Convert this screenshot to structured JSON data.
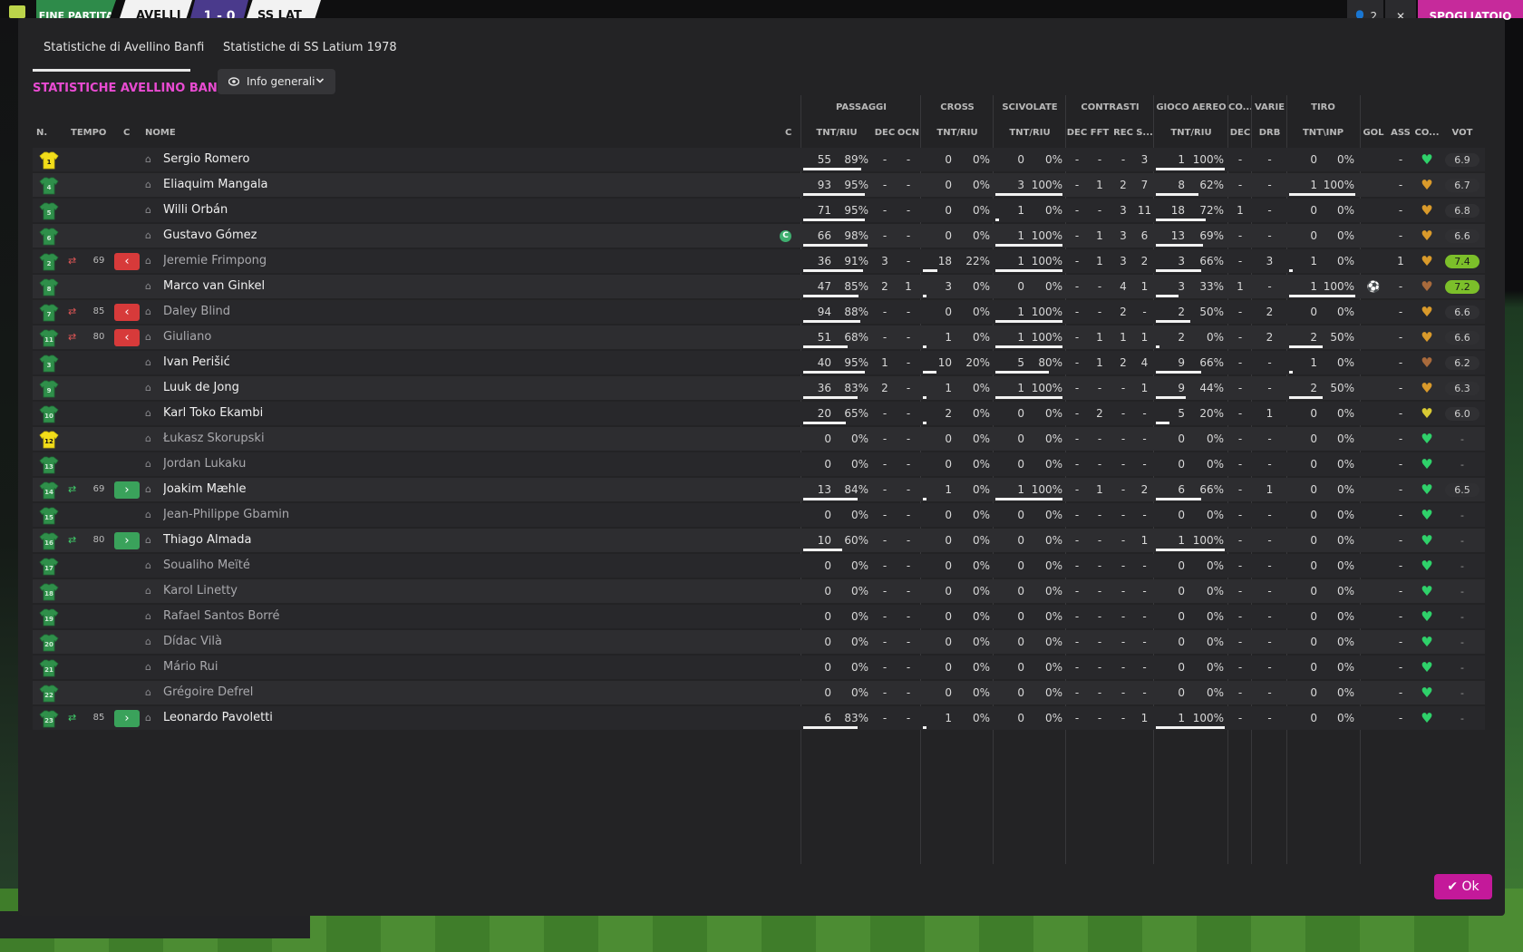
{
  "topbar": {
    "match_state": "FINE PARTITA",
    "home_short": "AVELLI",
    "score": "1 - 0",
    "away_short": "SS LAT",
    "btn_people": "👤 2",
    "btn_close": "✕",
    "locker_room": "SPOGLIATOIO"
  },
  "tabs": [
    "Statistiche di Avellino Banfi",
    "Statistiche di SS Latium 1978"
  ],
  "section_title": "STATISTICHE AVELLINO BANFI",
  "view_select": "Info generali",
  "groups": {
    "passaggi": "PASSAGGI",
    "cross": "CROSS",
    "scivolate": "SCIVOLATE",
    "contrasti": "CONTRASTI",
    "gioco_aereo": "GIOCO AEREO",
    "co": "CO...",
    "varie": "VARIE",
    "tiro": "TIRO"
  },
  "headers": {
    "n": "N.",
    "tempo": "TEMPO",
    "c": "C",
    "nome": "NOME",
    "c2": "C",
    "pass_tnt": "TNT/RIU",
    "pass_dec": "DEC",
    "pass_ocn": "OCN",
    "cross_tnt": "TNT/RIU",
    "sciv_tnt": "TNT/RIU",
    "con_dec": "DEC",
    "con_fft": "FFT",
    "con_rec": "REC",
    "con_s": "S...",
    "aereo_tnt": "TNT/RIU",
    "co_dec": "DEC",
    "varie_drb": "DRB",
    "tiro_tnt": "TNT\\INP",
    "gol": "GOL",
    "ass": "ASS",
    "cond": "CO...",
    "vot": "VOT"
  },
  "colors": {
    "accent": "#e94bd2",
    "ok": "#c4199a",
    "shirt_gk": "#f2dd1a",
    "shirt_field": "#2f8f4a",
    "sub_out": "#d73a3a",
    "sub_in": "#3aa25b"
  },
  "players": [
    {
      "num": "1",
      "gk": true,
      "sub": "",
      "min": "",
      "name": "Sergio Romero",
      "dim": false,
      "capt": false,
      "p": [
        "55",
        "89%"
      ],
      "pdec": "-",
      "pocn": "-",
      "cr": [
        "0",
        "0%"
      ],
      "sc": [
        "0",
        "0%"
      ],
      "cdec": "-",
      "cfft": "-",
      "crec": "-",
      "cs": "3",
      "ae": [
        "1",
        "100%"
      ],
      "codec": "-",
      "drb": "-",
      "ti": [
        "0",
        "0%"
      ],
      "gol": "",
      "ass": "-",
      "heart": "green",
      "vot": "6.9",
      "vhi": false
    },
    {
      "num": "4",
      "gk": false,
      "sub": "",
      "min": "",
      "name": "Eliaquim Mangala",
      "dim": false,
      "capt": false,
      "p": [
        "93",
        "95%"
      ],
      "pdec": "-",
      "pocn": "-",
      "cr": [
        "0",
        "0%"
      ],
      "sc": [
        "3",
        "100%"
      ],
      "cdec": "-",
      "cfft": "1",
      "crec": "2",
      "cs": "7",
      "ae": [
        "8",
        "62%"
      ],
      "codec": "-",
      "drb": "-",
      "ti": [
        "1",
        "100%"
      ],
      "gol": "",
      "ass": "-",
      "heart": "amber",
      "vot": "6.7",
      "vhi": false
    },
    {
      "num": "5",
      "gk": false,
      "sub": "",
      "min": "",
      "name": "Willi Orbán",
      "dim": false,
      "capt": false,
      "p": [
        "71",
        "95%"
      ],
      "pdec": "-",
      "pocn": "-",
      "cr": [
        "0",
        "0%"
      ],
      "sc": [
        "1",
        "0%"
      ],
      "cdec": "-",
      "cfft": "-",
      "crec": "3",
      "cs": "11",
      "ae": [
        "18",
        "72%"
      ],
      "codec": "1",
      "drb": "-",
      "ti": [
        "0",
        "0%"
      ],
      "gol": "",
      "ass": "-",
      "heart": "amber",
      "vot": "6.8",
      "vhi": false
    },
    {
      "num": "6",
      "gk": false,
      "sub": "",
      "min": "",
      "name": "Gustavo Gómez",
      "dim": false,
      "capt": true,
      "p": [
        "66",
        "98%"
      ],
      "pdec": "-",
      "pocn": "-",
      "cr": [
        "0",
        "0%"
      ],
      "sc": [
        "1",
        "100%"
      ],
      "cdec": "-",
      "cfft": "1",
      "crec": "3",
      "cs": "6",
      "ae": [
        "13",
        "69%"
      ],
      "codec": "-",
      "drb": "-",
      "ti": [
        "0",
        "0%"
      ],
      "gol": "",
      "ass": "-",
      "heart": "amber",
      "vot": "6.6",
      "vhi": false
    },
    {
      "num": "2",
      "gk": false,
      "sub": "out",
      "min": "69",
      "name": "Jeremie Frimpong",
      "dim": true,
      "capt": false,
      "p": [
        "36",
        "91%"
      ],
      "pdec": "3",
      "pocn": "-",
      "cr": [
        "18",
        "22%"
      ],
      "sc": [
        "1",
        "100%"
      ],
      "cdec": "-",
      "cfft": "1",
      "crec": "3",
      "cs": "2",
      "ae": [
        "3",
        "66%"
      ],
      "codec": "-",
      "drb": "3",
      "ti": [
        "1",
        "0%"
      ],
      "gol": "",
      "ass": "1",
      "heart": "amber",
      "vot": "7.4",
      "vhi": true
    },
    {
      "num": "8",
      "gk": false,
      "sub": "",
      "min": "",
      "name": "Marco van Ginkel",
      "dim": false,
      "capt": false,
      "p": [
        "47",
        "85%"
      ],
      "pdec": "2",
      "pocn": "1",
      "cr": [
        "3",
        "0%"
      ],
      "sc": [
        "0",
        "0%"
      ],
      "cdec": "-",
      "cfft": "-",
      "crec": "4",
      "cs": "1",
      "ae": [
        "3",
        "33%"
      ],
      "codec": "1",
      "drb": "-",
      "ti": [
        "1",
        "100%"
      ],
      "gol": "⚽",
      "ass": "-",
      "heart": "brown",
      "vot": "7.2",
      "vhi": true
    },
    {
      "num": "7",
      "gk": false,
      "sub": "out",
      "min": "85",
      "name": "Daley Blind",
      "dim": true,
      "capt": false,
      "p": [
        "94",
        "88%"
      ],
      "pdec": "-",
      "pocn": "-",
      "cr": [
        "0",
        "0%"
      ],
      "sc": [
        "1",
        "100%"
      ],
      "cdec": "-",
      "cfft": "-",
      "crec": "2",
      "cs": "-",
      "ae": [
        "2",
        "50%"
      ],
      "codec": "-",
      "drb": "2",
      "ti": [
        "0",
        "0%"
      ],
      "gol": "",
      "ass": "-",
      "heart": "amber",
      "vot": "6.6",
      "vhi": false
    },
    {
      "num": "11",
      "gk": false,
      "sub": "out",
      "min": "80",
      "name": "Giuliano",
      "dim": true,
      "capt": false,
      "p": [
        "51",
        "68%"
      ],
      "pdec": "-",
      "pocn": "-",
      "cr": [
        "1",
        "0%"
      ],
      "sc": [
        "1",
        "100%"
      ],
      "cdec": "-",
      "cfft": "1",
      "crec": "1",
      "cs": "1",
      "ae": [
        "2",
        "0%"
      ],
      "codec": "-",
      "drb": "2",
      "ti": [
        "2",
        "50%"
      ],
      "gol": "",
      "ass": "-",
      "heart": "amber",
      "vot": "6.6",
      "vhi": false
    },
    {
      "num": "3",
      "gk": false,
      "sub": "",
      "min": "",
      "name": "Ivan Perišić",
      "dim": false,
      "capt": false,
      "p": [
        "40",
        "95%"
      ],
      "pdec": "1",
      "pocn": "-",
      "cr": [
        "10",
        "20%"
      ],
      "sc": [
        "5",
        "80%"
      ],
      "cdec": "-",
      "cfft": "1",
      "crec": "2",
      "cs": "4",
      "ae": [
        "9",
        "66%"
      ],
      "codec": "-",
      "drb": "-",
      "ti": [
        "1",
        "0%"
      ],
      "gol": "",
      "ass": "-",
      "heart": "brown",
      "vot": "6.2",
      "vhi": false
    },
    {
      "num": "9",
      "gk": false,
      "sub": "",
      "min": "",
      "name": "Luuk de Jong",
      "dim": false,
      "capt": false,
      "p": [
        "36",
        "83%"
      ],
      "pdec": "2",
      "pocn": "-",
      "cr": [
        "1",
        "0%"
      ],
      "sc": [
        "1",
        "100%"
      ],
      "cdec": "-",
      "cfft": "-",
      "crec": "-",
      "cs": "1",
      "ae": [
        "9",
        "44%"
      ],
      "codec": "-",
      "drb": "-",
      "ti": [
        "2",
        "50%"
      ],
      "gol": "",
      "ass": "-",
      "heart": "amber",
      "vot": "6.3",
      "vhi": false
    },
    {
      "num": "10",
      "gk": false,
      "sub": "",
      "min": "",
      "name": "Karl Toko Ekambi",
      "dim": false,
      "capt": false,
      "p": [
        "20",
        "65%"
      ],
      "pdec": "-",
      "pocn": "-",
      "cr": [
        "2",
        "0%"
      ],
      "sc": [
        "0",
        "0%"
      ],
      "cdec": "-",
      "cfft": "2",
      "crec": "-",
      "cs": "-",
      "ae": [
        "5",
        "20%"
      ],
      "codec": "-",
      "drb": "1",
      "ti": [
        "0",
        "0%"
      ],
      "gol": "",
      "ass": "-",
      "heart": "yellow",
      "vot": "6.0",
      "vhi": false
    },
    {
      "num": "12",
      "gk": true,
      "sub": "",
      "min": "",
      "name": "Łukasz Skorupski",
      "dim": true,
      "capt": false,
      "p": [
        "0",
        "0%"
      ],
      "pdec": "-",
      "pocn": "-",
      "cr": [
        "0",
        "0%"
      ],
      "sc": [
        "0",
        "0%"
      ],
      "cdec": "-",
      "cfft": "-",
      "crec": "-",
      "cs": "-",
      "ae": [
        "0",
        "0%"
      ],
      "codec": "-",
      "drb": "-",
      "ti": [
        "0",
        "0%"
      ],
      "gol": "",
      "ass": "-",
      "heart": "green",
      "vot": "-",
      "vhi": false
    },
    {
      "num": "13",
      "gk": false,
      "sub": "",
      "min": "",
      "name": "Jordan Lukaku",
      "dim": true,
      "capt": false,
      "p": [
        "0",
        "0%"
      ],
      "pdec": "-",
      "pocn": "-",
      "cr": [
        "0",
        "0%"
      ],
      "sc": [
        "0",
        "0%"
      ],
      "cdec": "-",
      "cfft": "-",
      "crec": "-",
      "cs": "-",
      "ae": [
        "0",
        "0%"
      ],
      "codec": "-",
      "drb": "-",
      "ti": [
        "0",
        "0%"
      ],
      "gol": "",
      "ass": "-",
      "heart": "green",
      "vot": "-",
      "vhi": false
    },
    {
      "num": "14",
      "gk": false,
      "sub": "in",
      "min": "69",
      "name": "Joakim Mæhle",
      "dim": false,
      "capt": false,
      "p": [
        "13",
        "84%"
      ],
      "pdec": "-",
      "pocn": "-",
      "cr": [
        "1",
        "0%"
      ],
      "sc": [
        "1",
        "100%"
      ],
      "cdec": "-",
      "cfft": "1",
      "crec": "-",
      "cs": "2",
      "ae": [
        "6",
        "66%"
      ],
      "codec": "-",
      "drb": "1",
      "ti": [
        "0",
        "0%"
      ],
      "gol": "",
      "ass": "-",
      "heart": "green",
      "vot": "6.5",
      "vhi": false
    },
    {
      "num": "15",
      "gk": false,
      "sub": "",
      "min": "",
      "name": "Jean-Philippe Gbamin",
      "dim": true,
      "capt": false,
      "p": [
        "0",
        "0%"
      ],
      "pdec": "-",
      "pocn": "-",
      "cr": [
        "0",
        "0%"
      ],
      "sc": [
        "0",
        "0%"
      ],
      "cdec": "-",
      "cfft": "-",
      "crec": "-",
      "cs": "-",
      "ae": [
        "0",
        "0%"
      ],
      "codec": "-",
      "drb": "-",
      "ti": [
        "0",
        "0%"
      ],
      "gol": "",
      "ass": "-",
      "heart": "green",
      "vot": "-",
      "vhi": false
    },
    {
      "num": "16",
      "gk": false,
      "sub": "in",
      "min": "80",
      "name": "Thiago Almada",
      "dim": false,
      "capt": false,
      "p": [
        "10",
        "60%"
      ],
      "pdec": "-",
      "pocn": "-",
      "cr": [
        "0",
        "0%"
      ],
      "sc": [
        "0",
        "0%"
      ],
      "cdec": "-",
      "cfft": "-",
      "crec": "-",
      "cs": "1",
      "ae": [
        "1",
        "100%"
      ],
      "codec": "-",
      "drb": "-",
      "ti": [
        "0",
        "0%"
      ],
      "gol": "",
      "ass": "-",
      "heart": "green",
      "vot": "-",
      "vhi": false
    },
    {
      "num": "17",
      "gk": false,
      "sub": "",
      "min": "",
      "name": "Soualiho Meïté",
      "dim": true,
      "capt": false,
      "p": [
        "0",
        "0%"
      ],
      "pdec": "-",
      "pocn": "-",
      "cr": [
        "0",
        "0%"
      ],
      "sc": [
        "0",
        "0%"
      ],
      "cdec": "-",
      "cfft": "-",
      "crec": "-",
      "cs": "-",
      "ae": [
        "0",
        "0%"
      ],
      "codec": "-",
      "drb": "-",
      "ti": [
        "0",
        "0%"
      ],
      "gol": "",
      "ass": "-",
      "heart": "green",
      "vot": "-",
      "vhi": false
    },
    {
      "num": "18",
      "gk": false,
      "sub": "",
      "min": "",
      "name": "Karol Linetty",
      "dim": true,
      "capt": false,
      "p": [
        "0",
        "0%"
      ],
      "pdec": "-",
      "pocn": "-",
      "cr": [
        "0",
        "0%"
      ],
      "sc": [
        "0",
        "0%"
      ],
      "cdec": "-",
      "cfft": "-",
      "crec": "-",
      "cs": "-",
      "ae": [
        "0",
        "0%"
      ],
      "codec": "-",
      "drb": "-",
      "ti": [
        "0",
        "0%"
      ],
      "gol": "",
      "ass": "-",
      "heart": "green",
      "vot": "-",
      "vhi": false
    },
    {
      "num": "19",
      "gk": false,
      "sub": "",
      "min": "",
      "name": "Rafael Santos Borré",
      "dim": true,
      "capt": false,
      "p": [
        "0",
        "0%"
      ],
      "pdec": "-",
      "pocn": "-",
      "cr": [
        "0",
        "0%"
      ],
      "sc": [
        "0",
        "0%"
      ],
      "cdec": "-",
      "cfft": "-",
      "crec": "-",
      "cs": "-",
      "ae": [
        "0",
        "0%"
      ],
      "codec": "-",
      "drb": "-",
      "ti": [
        "0",
        "0%"
      ],
      "gol": "",
      "ass": "-",
      "heart": "green",
      "vot": "-",
      "vhi": false
    },
    {
      "num": "20",
      "gk": false,
      "sub": "",
      "min": "",
      "name": "Dídac Vilà",
      "dim": true,
      "capt": false,
      "p": [
        "0",
        "0%"
      ],
      "pdec": "-",
      "pocn": "-",
      "cr": [
        "0",
        "0%"
      ],
      "sc": [
        "0",
        "0%"
      ],
      "cdec": "-",
      "cfft": "-",
      "crec": "-",
      "cs": "-",
      "ae": [
        "0",
        "0%"
      ],
      "codec": "-",
      "drb": "-",
      "ti": [
        "0",
        "0%"
      ],
      "gol": "",
      "ass": "-",
      "heart": "green",
      "vot": "-",
      "vhi": false
    },
    {
      "num": "21",
      "gk": false,
      "sub": "",
      "min": "",
      "name": "Mário Rui",
      "dim": true,
      "capt": false,
      "p": [
        "0",
        "0%"
      ],
      "pdec": "-",
      "pocn": "-",
      "cr": [
        "0",
        "0%"
      ],
      "sc": [
        "0",
        "0%"
      ],
      "cdec": "-",
      "cfft": "-",
      "crec": "-",
      "cs": "-",
      "ae": [
        "0",
        "0%"
      ],
      "codec": "-",
      "drb": "-",
      "ti": [
        "0",
        "0%"
      ],
      "gol": "",
      "ass": "-",
      "heart": "green",
      "vot": "-",
      "vhi": false
    },
    {
      "num": "22",
      "gk": false,
      "sub": "",
      "min": "",
      "name": "Grégoire Defrel",
      "dim": true,
      "capt": false,
      "p": [
        "0",
        "0%"
      ],
      "pdec": "-",
      "pocn": "-",
      "cr": [
        "0",
        "0%"
      ],
      "sc": [
        "0",
        "0%"
      ],
      "cdec": "-",
      "cfft": "-",
      "crec": "-",
      "cs": "-",
      "ae": [
        "0",
        "0%"
      ],
      "codec": "-",
      "drb": "-",
      "ti": [
        "0",
        "0%"
      ],
      "gol": "",
      "ass": "-",
      "heart": "green",
      "vot": "-",
      "vhi": false
    },
    {
      "num": "23",
      "gk": false,
      "sub": "in",
      "min": "85",
      "name": "Leonardo Pavoletti",
      "dim": false,
      "capt": false,
      "p": [
        "6",
        "83%"
      ],
      "pdec": "-",
      "pocn": "-",
      "cr": [
        "1",
        "0%"
      ],
      "sc": [
        "0",
        "0%"
      ],
      "cdec": "-",
      "cfft": "-",
      "crec": "-",
      "cs": "1",
      "ae": [
        "1",
        "100%"
      ],
      "codec": "-",
      "drb": "-",
      "ti": [
        "0",
        "0%"
      ],
      "gol": "",
      "ass": "-",
      "heart": "green",
      "vot": "-",
      "vhi": false
    }
  ],
  "ok_label": "Ok"
}
